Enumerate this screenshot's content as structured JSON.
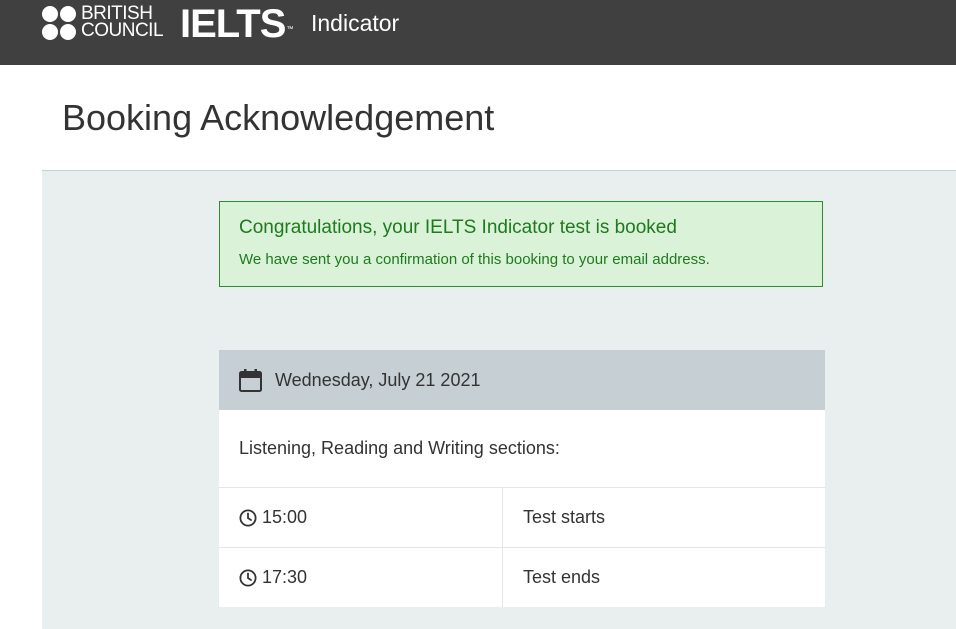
{
  "header": {
    "brand_line1": "BRITISH",
    "brand_line2": "COUNCIL",
    "product_logo": "IELTS",
    "trademark": "™",
    "product_name": "Indicator",
    "background_color": "#404040"
  },
  "page": {
    "title": "Booking Acknowledgement"
  },
  "alert": {
    "title": "Congratulations, your IELTS Indicator test is booked",
    "message": "We have sent you a confirmation of this booking to your email address.",
    "color": "#2e8c2a",
    "background": "#daf2d7"
  },
  "booking": {
    "icon": "calendar-icon",
    "date": "Wednesday, July 21 2021",
    "sections_label": "Listening, Reading and Writing sections:",
    "rows": [
      {
        "icon": "clock-icon",
        "time": "15:00",
        "label": "Test starts"
      },
      {
        "icon": "clock-icon",
        "time": "17:30",
        "label": "Test ends"
      }
    ]
  }
}
